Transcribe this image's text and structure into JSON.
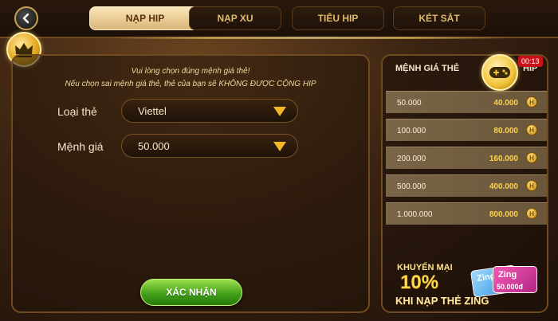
{
  "tabs": [
    {
      "label": "NẠP HIP",
      "active": true
    },
    {
      "label": "NẠP XU",
      "active": false
    },
    {
      "label": "TIÊU HIP",
      "active": false
    },
    {
      "label": "KÉT SẮT",
      "active": false
    }
  ],
  "notice": {
    "line1": "Vui lòng chọn đúng mệnh giá thẻ!",
    "line2": "Nếu chọn sai mệnh giá thẻ, thẻ của bạn sẽ KHÔNG ĐƯỢC CỘNG HIP"
  },
  "form": {
    "card_type_label": "Loại thẻ",
    "card_type_value": "Viettel",
    "denomination_label": "Mệnh giá",
    "denomination_value": "50.000",
    "confirm_label": "XÁC NHẬN"
  },
  "price_table": {
    "header_card": "MỆNH GIÁ THẺ",
    "header_hip": "HIP",
    "rows": [
      {
        "card": "50.000",
        "hip": "40.000"
      },
      {
        "card": "100.000",
        "hip": "80.000"
      },
      {
        "card": "200.000",
        "hip": "160.000"
      },
      {
        "card": "500.000",
        "hip": "400.000"
      },
      {
        "card": "1.000.000",
        "hip": "800.000"
      }
    ],
    "coin_symbol": "H"
  },
  "timer": "00:13",
  "promo": {
    "line1": "KHUYẾN MẠI",
    "line2": "10%",
    "line3": "KHI NẠP THẺ ZING",
    "card_brand": "Zing",
    "card_value": "50.000đ"
  },
  "icons": {
    "back": "chevron-left-icon",
    "crown": "crown-icon",
    "game": "gamepad-icon",
    "coin": "hip-coin-icon"
  },
  "colors": {
    "accent_gold": "#f2b626",
    "confirm_green": "#3e9b16",
    "timer_red": "#c8121a"
  }
}
